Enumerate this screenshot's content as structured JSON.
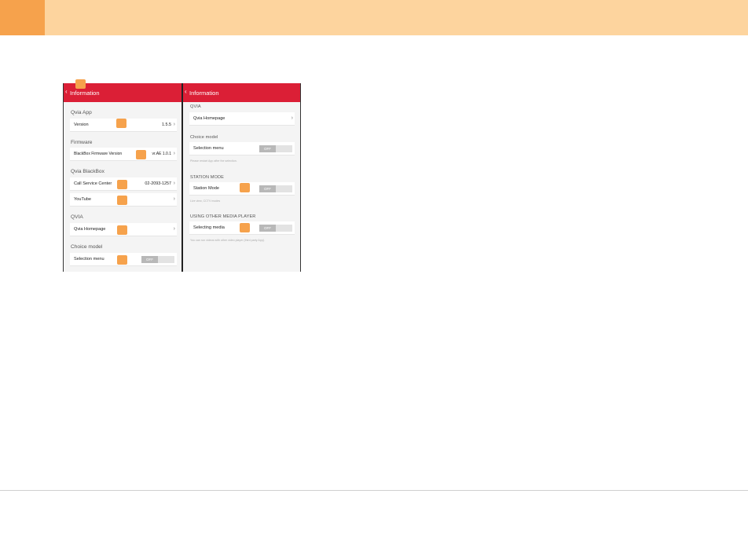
{
  "colors": {
    "accent": "#f6a24c",
    "band": "#fdd49e",
    "header_red": "#db1f36"
  },
  "left_screen": {
    "header": {
      "back_icon": "chevron-left-icon",
      "title": "Information"
    },
    "sections": {
      "qvia_app": {
        "title": "Qvia App",
        "version_label": "Version",
        "version_value": "1.5.5"
      },
      "firmware": {
        "title": "Firmware",
        "fw_label": "BlackBox Firmware Version",
        "fw_value": "vr.AE 1.0.1"
      },
      "qvia_blackbox": {
        "title": "Qvia BlackBox",
        "call_label": "Call Service Center",
        "call_value": "02-2093-1257",
        "youtube_label": "YouTube"
      },
      "qvia": {
        "title": "QVIA",
        "homepage_label": "Qvia Homepage"
      },
      "choice_model": {
        "title": "Choice model",
        "selection_label": "Selection menu",
        "toggle_text": "OFF"
      }
    }
  },
  "right_screen": {
    "header": {
      "back_icon": "chevron-left-icon",
      "title": "Information"
    },
    "sections": {
      "qvia": {
        "title": "QVIA",
        "homepage_label": "Qvia Homepage"
      },
      "choice_model": {
        "title": "Choice model",
        "selection_label": "Selection menu",
        "toggle_text": "OFF",
        "note": "Please restart App after the selection."
      },
      "station_mode": {
        "title": "STATION MODE",
        "station_label": "Station Mode",
        "toggle_text": "OFF",
        "note": "Live view, CCTV modes"
      },
      "other_player": {
        "title": "USING OTHER MEDIA PLAYER",
        "media_label": "Selecting media",
        "toggle_text": "OFF",
        "note": "You can run videos with other video player (third party App)."
      }
    }
  }
}
